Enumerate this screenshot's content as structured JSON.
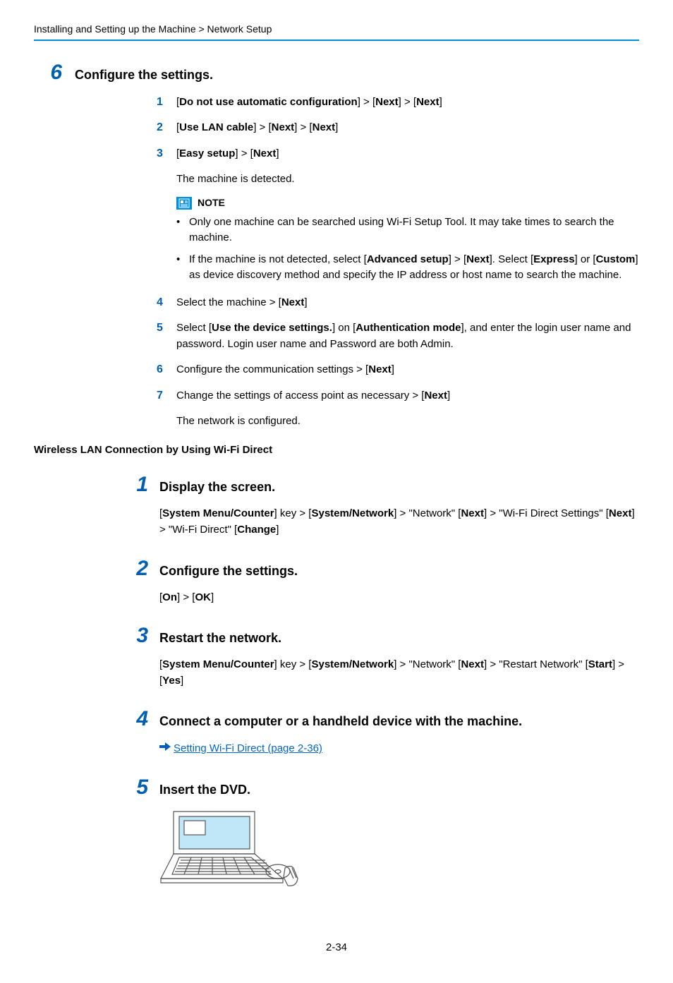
{
  "breadcrumb": "Installing and Setting up the Machine > Network Setup",
  "pageNumber": "2-34",
  "section1": {
    "number": "6",
    "title": "Configure the settings.",
    "subs": {
      "s1": {
        "num": "1"
      },
      "s2": {
        "num": "2"
      },
      "s3": {
        "num": "3",
        "detail": "The machine is detected."
      },
      "note": {
        "label": "NOTE",
        "bullet1": "Only one machine can be searched using Wi-Fi Setup Tool. It may take times to search the machine."
      },
      "s4": {
        "num": "4"
      },
      "s5": {
        "num": "5"
      },
      "s6": {
        "num": "6"
      },
      "s7": {
        "num": "7",
        "detail": "The network is configured."
      }
    }
  },
  "section2Heading": "Wireless LAN Connection by Using Wi-Fi Direct",
  "steps": {
    "st1": {
      "num": "1",
      "title": "Display the screen."
    },
    "st2": {
      "num": "2",
      "title": "Configure the settings."
    },
    "st3": {
      "num": "3",
      "title": "Restart the network."
    },
    "st4": {
      "num": "4",
      "title": "Connect a computer or a handheld device with the machine.",
      "xref": "Setting Wi-Fi Direct (page 2-36)"
    },
    "st5": {
      "num": "5",
      "title": "Insert the DVD."
    }
  }
}
